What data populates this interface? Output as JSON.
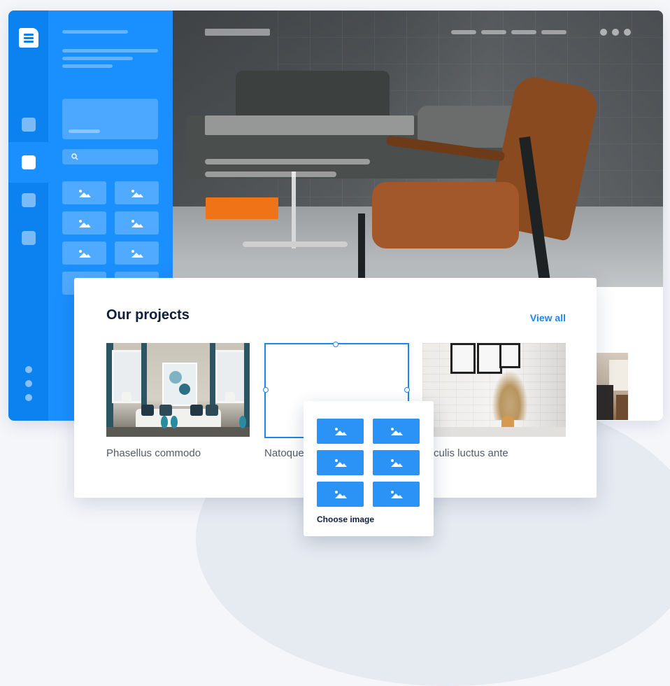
{
  "card": {
    "title": "Our projects",
    "view_all_label": "View all",
    "projects": [
      {
        "label": "Phasellus commodo"
      },
      {
        "label": "Natoque"
      },
      {
        "label": "culis luctus ante"
      }
    ]
  },
  "picker": {
    "label": "Choose image"
  },
  "colors": {
    "accent": "#1a86f0",
    "rail": "#0b82f0",
    "panel": "#1a90ff",
    "cta": "#f07317",
    "heading": "#0f1e3c"
  },
  "icons": {
    "logo": "editor-logo-icon",
    "search": "search-icon",
    "image": "image-icon"
  }
}
